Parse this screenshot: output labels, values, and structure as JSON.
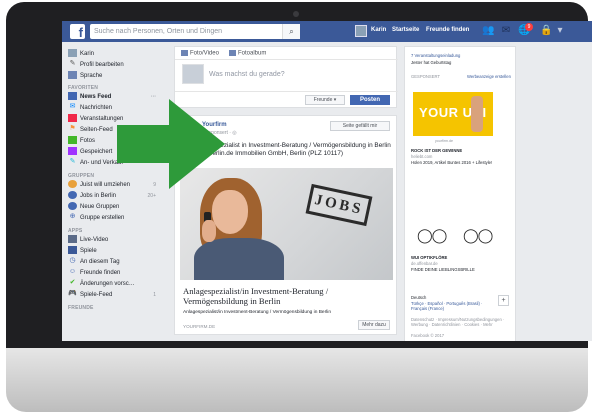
{
  "topbar": {
    "search_placeholder": "Suche nach Personen, Orten und Dingen",
    "user_name": "Karin",
    "home_label": "Startseite",
    "find_friends_label": "Freunde finden",
    "notification_count": "9"
  },
  "sidebar": {
    "profile": [
      {
        "label": "Karin",
        "icon": "avatar-icon"
      },
      {
        "label": "Profil bearbeiten",
        "icon": "pencil-icon"
      },
      {
        "label": "Sprache",
        "icon": "language-icon"
      }
    ],
    "favorites_title": "FAVORITEN",
    "favorites": [
      {
        "label": "News Feed",
        "icon": "newsfeed-icon",
        "count": "···"
      },
      {
        "label": "Nachrichten",
        "icon": "messages-icon",
        "count": ""
      },
      {
        "label": "Veranstaltungen",
        "icon": "calendar-icon",
        "count": ""
      },
      {
        "label": "Seiten-Feed",
        "icon": "flag-icon",
        "count": ""
      },
      {
        "label": "Fotos",
        "icon": "photo-icon",
        "count": ""
      },
      {
        "label": "Gespeichert",
        "icon": "bookmark-icon",
        "count": ""
      },
      {
        "label": "An- und Verkauf",
        "icon": "tag-icon",
        "count": ""
      }
    ],
    "groups_title": "GRUPPEN",
    "groups": [
      {
        "label": "Juist will umziehen",
        "icon": "group-icon",
        "count": "9"
      },
      {
        "label": "Jobs in Berlin",
        "icon": "group-icon",
        "count": "20+"
      },
      {
        "label": "Neue Gruppen",
        "icon": "group-icon",
        "count": ""
      },
      {
        "label": "Gruppe erstellen",
        "icon": "plus-icon",
        "count": ""
      }
    ],
    "apps_title": "APPS",
    "apps": [
      {
        "label": "Live-Video",
        "icon": "video-icon",
        "count": ""
      },
      {
        "label": "Spiele",
        "icon": "game-icon",
        "count": ""
      },
      {
        "label": "An diesem Tag",
        "icon": "clock-icon",
        "count": ""
      },
      {
        "label": "Freunde finden",
        "icon": "friends-icon",
        "count": ""
      },
      {
        "label": "Änderungen vorsc…",
        "icon": "check-icon",
        "count": ""
      },
      {
        "label": "Spiele-Feed",
        "icon": "controller-icon",
        "count": "1"
      }
    ],
    "friends_title": "FREUNDE"
  },
  "composer": {
    "tab_photo": "Foto/Video",
    "tab_album": "Fotoalbum",
    "placeholder": "Was machst du gerade?",
    "audience": "Freunde ▾",
    "post_button": "Posten"
  },
  "post": {
    "page_name": "Yourfirm",
    "meta": "Gesponsert · ◎",
    "like_page": "Seite gefällt mir",
    "text_line1": "+++ Anlagespezialist in Investment-Beratung / Vermögensbildung in Berlin",
    "text_line2": "+++ wokaberlin.de Immobilien GmbH, Berlin (PLZ 10117)",
    "stamp": "JOBS",
    "card_title": "Anlagespezialist/in Investment-Beratung / Vermögensbildung in Berlin",
    "card_subtitle": "Anlagespezialist/in Investment-Beratung / Vermögensbildung in Berlin",
    "card_domain": "YOURFIRM.DE",
    "more_button": "Mehr dazu"
  },
  "right_column": {
    "event_text": "7 Veranstaltungseinladung",
    "event_sub": "Jester hat Geburtstag",
    "sponsored_label": "GESPONSERT",
    "create_ad": "Werbeanzeige erstellen",
    "ad_banner_text": "YOUR UNI",
    "ad_caption": "yourfirm.de",
    "ad2_title": "ROCK IST DER GEWINNE",
    "ad2_sub": "heliebt.com",
    "ad2_text": "Holen 2019, Artikel Buntes 2016 + Lifestyle!",
    "ad3_title": "WUI OPTIKFLÖRE",
    "ad3_sub": "de.offenbar.de",
    "ad3_text": "FINDE DEINE LIEBLINGSBRILLE",
    "lang_label": "Deutsch",
    "lang_options": "Türkçe · Español · Português (Brasil) · Français (France)",
    "footer": "Datenschutz · Impressum/Nutzungsbedingungen · Werbung · Datenrichtlinien · Cookies · Mehr",
    "copyright": "Facebook © 2017"
  },
  "colors": {
    "facebook_blue": "#3b5998",
    "arrow_green": "#2e9a3a",
    "ad_yellow": "#f5c400"
  }
}
